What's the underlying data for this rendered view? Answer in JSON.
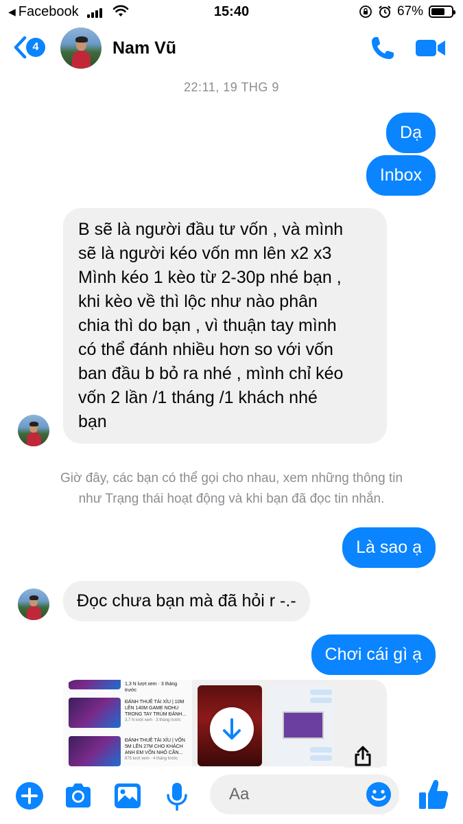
{
  "status_bar": {
    "back_app": "Facebook",
    "time": "15:40",
    "battery": "67%",
    "battery_level": 0.67
  },
  "header": {
    "back_badge": "4",
    "contact_name": "Nam Vũ",
    "icons": [
      "chevron-left-icon",
      "phone-icon",
      "video-camera-icon"
    ]
  },
  "chat": {
    "timestamp": "22:11, 19 THG 9",
    "messages": [
      {
        "side": "out",
        "text": "Dạ"
      },
      {
        "side": "out",
        "text": "Inbox"
      },
      {
        "side": "in",
        "lines": [
          "B sẽ là người đầu tư vốn , và mình",
          "sẽ là người kéo vốn mn lên x2 x3",
          "Mình kéo 1 kèo từ 2-30p nhé bạn ,",
          "khi kèo về thì lộc như nào phân",
          "chia thì do bạn , vì thuận tay mình",
          "có thể đánh nhiều hơn so với vốn",
          "ban đầu b bỏ ra nhé , mình chỉ kéo",
          "vốn 2 lần /1 tháng /1 khách nhé",
          "bạn"
        ]
      },
      {
        "side": "out",
        "text": "Là sao ạ"
      },
      {
        "side": "in",
        "text": "Đọc chưa bạn mà đã hỏi r -.-"
      },
      {
        "side": "out",
        "text": "Chơi cái gì ạ"
      }
    ],
    "system_note_lines": [
      "Giờ đây, các bạn có thể gọi cho nhau, xem những thông tin",
      "như Trạng thái hoạt động và khi bạn đã đọc tin nhắn."
    ],
    "share_preview": {
      "videos": [
        {
          "title": "ĐÁNH THUÊ TÀI XỈU | 10M LÊN 140M GAME NOHU TRONG TAY TRÙM ĐÁNH...",
          "meta": "3,7 N lượt xem · 3 tháng trước"
        },
        {
          "title": "ĐÁNH THUÊ TÀI XỈU | VỐN 5M LÊN 27M CHO KHÁCH ANH EM VỐN NHỎ CẦN...",
          "meta": "875 lượt xem · 4 tháng trước"
        }
      ],
      "top_meta": "1,3 N lượt xem · 3 tháng trước",
      "durations": [
        "6:33",
        "14:59",
        "15:45"
      ]
    }
  },
  "composer": {
    "placeholder": "Aa",
    "icons": [
      "plus-icon",
      "camera-icon",
      "image-icon",
      "microphone-icon",
      "emoji-icon",
      "thumbs-up-icon"
    ]
  },
  "colors": {
    "accent": "#0a84ff",
    "incoming_bubble": "#f0f0f0",
    "muted_text": "#8a8d91"
  }
}
